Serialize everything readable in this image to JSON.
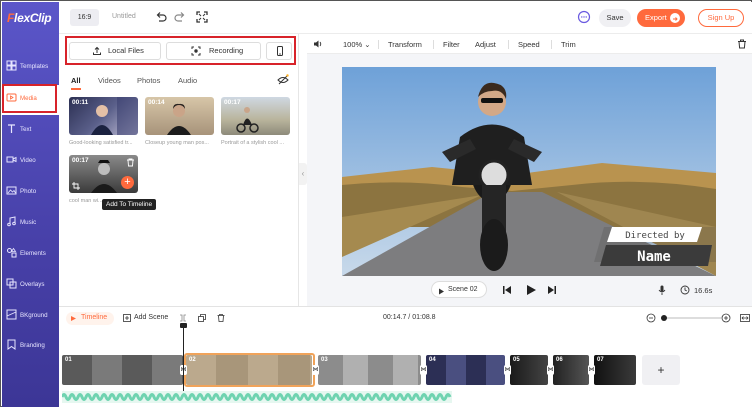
{
  "app": {
    "logo_prefix": "F",
    "logo_rest": "lexClip",
    "ratio": "16:9",
    "project_title": "Untitled",
    "save_label": "Save",
    "export_label": "Export",
    "signup_label": "Sign Up"
  },
  "sidebar": {
    "items": [
      {
        "label": "Templates",
        "icon": "templates-icon"
      },
      {
        "label": "Media",
        "icon": "media-icon",
        "active": true
      },
      {
        "label": "Text",
        "icon": "text-icon"
      },
      {
        "label": "Video",
        "icon": "video-icon"
      },
      {
        "label": "Photo",
        "icon": "photo-icon"
      },
      {
        "label": "Music",
        "icon": "music-icon"
      },
      {
        "label": "Elements",
        "icon": "elements-icon"
      },
      {
        "label": "Overlays",
        "icon": "overlays-icon"
      },
      {
        "label": "BKground",
        "icon": "background-icon"
      },
      {
        "label": "Branding",
        "icon": "branding-icon"
      }
    ]
  },
  "media": {
    "local_files_label": "Local Files",
    "recording_label": "Recording",
    "tabs": [
      "All",
      "Videos",
      "Photos",
      "Audio"
    ],
    "thumbs": [
      {
        "duration": "00:11",
        "caption": "Good-looking satisfied tr..."
      },
      {
        "duration": "00:14",
        "caption": "Closeup young man pos..."
      },
      {
        "duration": "00:17",
        "caption": "Portrait of a stylish cool ..."
      },
      {
        "duration": "00:17",
        "caption": "cool man wi..."
      }
    ],
    "tooltip": "Add To Timeline"
  },
  "edit_bar": {
    "zoom": "100%",
    "transform": "Transform",
    "filter": "Filter",
    "adjust": "Adjust",
    "speed": "Speed",
    "trim": "Trim"
  },
  "preview": {
    "overlay_small": "Directed by",
    "overlay_big": "Name",
    "scene_label": "Scene 02",
    "duration": "16.6s"
  },
  "timeline": {
    "label": "Timeline",
    "add_scene": "Add Scene",
    "time": "00:14.7 / 01:08.8",
    "clips": [
      "01",
      "02",
      "03",
      "04",
      "05",
      "06",
      "07"
    ],
    "add_label": "+"
  },
  "colors": {
    "accent": "#ff6a3d",
    "sidebar": "#4f49b8",
    "highlight_box": "#d8232a",
    "selected_clip": "#f0a35a",
    "audio_wave": "#6fd3b0"
  }
}
